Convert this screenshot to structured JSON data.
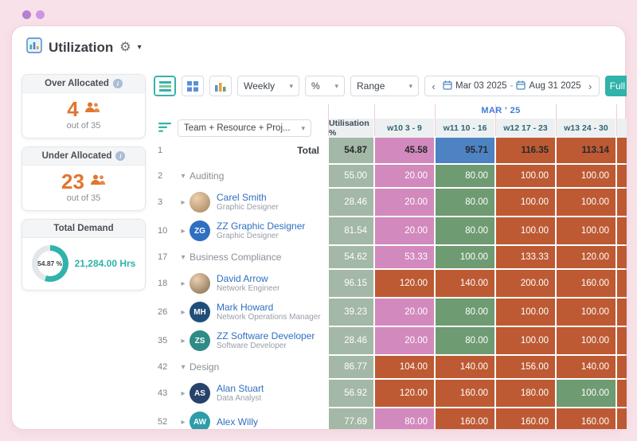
{
  "header": {
    "title": "Utilization"
  },
  "sidebar": {
    "over_allocated": {
      "label": "Over Allocated",
      "value": "4",
      "suffix": "out of 35"
    },
    "under_allocated": {
      "label": "Under Allocated",
      "value": "23",
      "suffix": "out of 35"
    },
    "total_demand": {
      "label": "Total Demand",
      "percent_text": "54.87 %",
      "percent_value": 54.87,
      "hours": "21,284.00 Hrs"
    }
  },
  "toolbar": {
    "period_select": "Weekly",
    "unit_select": "%",
    "range_select": "Range",
    "date_from": "Mar 03 2025",
    "date_separator": "-",
    "date_to": "Aug 31 2025",
    "full_button": "Full"
  },
  "palette": {
    "sage": "#a3b8a6",
    "pink": "#d289bd",
    "green": "#6e9b72",
    "red": "#bd5a33",
    "blue": "#4d82c3",
    "teal": "#2fb3aa",
    "orange": "#e0762f"
  },
  "table": {
    "month_label": "MAR ' 25",
    "columns": {
      "entity": "Team + Resource + Proj...",
      "utilisation": "Utilisation %",
      "weeks": [
        "w10 3 - 9",
        "w11 10 - 16",
        "w12 17 - 23",
        "w13 24 - 30"
      ]
    },
    "rows": [
      {
        "num": "1",
        "type": "total",
        "name": "Total",
        "util": "54.87",
        "cells": [
          {
            "v": "45.58",
            "c": "pink"
          },
          {
            "v": "95.71",
            "c": "blue"
          },
          {
            "v": "116.35",
            "c": "red"
          },
          {
            "v": "113.14",
            "c": "red"
          }
        ],
        "edge": "red"
      },
      {
        "num": "2",
        "type": "group",
        "name": "Auditing",
        "expanded": true,
        "util": "55.00",
        "cells": [
          {
            "v": "20.00",
            "c": "pink"
          },
          {
            "v": "80.00",
            "c": "green"
          },
          {
            "v": "100.00",
            "c": "red"
          },
          {
            "v": "100.00",
            "c": "red"
          }
        ],
        "edge": "red"
      },
      {
        "num": "3",
        "type": "resource",
        "name": "Carel Smith",
        "role": "Graphic Designer",
        "avatar": {
          "kind": "photo",
          "initials": "CS",
          "color": "#a5825f"
        },
        "util": "28.46",
        "cells": [
          {
            "v": "20.00",
            "c": "pink"
          },
          {
            "v": "80.00",
            "c": "green"
          },
          {
            "v": "100.00",
            "c": "red"
          },
          {
            "v": "100.00",
            "c": "red"
          }
        ],
        "edge": "red"
      },
      {
        "num": "10",
        "type": "resource",
        "name": "ZZ Graphic Designer",
        "role": "Graphic Designer",
        "avatar": {
          "kind": "initials",
          "initials": "ZG",
          "color": "#2f6fc2"
        },
        "util": "81.54",
        "cells": [
          {
            "v": "20.00",
            "c": "pink"
          },
          {
            "v": "80.00",
            "c": "green"
          },
          {
            "v": "100.00",
            "c": "red"
          },
          {
            "v": "100.00",
            "c": "red"
          }
        ],
        "edge": "red"
      },
      {
        "num": "17",
        "type": "group",
        "name": "Business Compliance",
        "expanded": true,
        "util": "54.62",
        "cells": [
          {
            "v": "53.33",
            "c": "pink"
          },
          {
            "v": "100.00",
            "c": "green"
          },
          {
            "v": "133.33",
            "c": "red"
          },
          {
            "v": "120.00",
            "c": "red"
          }
        ],
        "edge": "red"
      },
      {
        "num": "18",
        "type": "resource",
        "name": "David Arrow",
        "role": "Network Engineer",
        "avatar": {
          "kind": "photo",
          "initials": "DA",
          "color": "#7d6a4f"
        },
        "util": "96.15",
        "cells": [
          {
            "v": "120.00",
            "c": "red"
          },
          {
            "v": "140.00",
            "c": "red"
          },
          {
            "v": "200.00",
            "c": "red"
          },
          {
            "v": "160.00",
            "c": "red"
          }
        ],
        "edge": "red"
      },
      {
        "num": "26",
        "type": "resource",
        "name": "Mark Howard",
        "role": "Network Operations Manager",
        "avatar": {
          "kind": "initials",
          "initials": "MH",
          "color": "#1f4e79"
        },
        "util": "39.23",
        "cells": [
          {
            "v": "20.00",
            "c": "pink"
          },
          {
            "v": "80.00",
            "c": "green"
          },
          {
            "v": "100.00",
            "c": "red"
          },
          {
            "v": "100.00",
            "c": "red"
          }
        ],
        "edge": "red"
      },
      {
        "num": "35",
        "type": "resource",
        "name": "ZZ Software Developer",
        "role": "Software Developer",
        "avatar": {
          "kind": "initials",
          "initials": "ZS",
          "color": "#2e8b85"
        },
        "util": "28.46",
        "cells": [
          {
            "v": "20.00",
            "c": "pink"
          },
          {
            "v": "80.00",
            "c": "green"
          },
          {
            "v": "100.00",
            "c": "red"
          },
          {
            "v": "100.00",
            "c": "red"
          }
        ],
        "edge": "red"
      },
      {
        "num": "42",
        "type": "group",
        "name": "Design",
        "expanded": true,
        "util": "86.77",
        "cells": [
          {
            "v": "104.00",
            "c": "red"
          },
          {
            "v": "140.00",
            "c": "red"
          },
          {
            "v": "156.00",
            "c": "red"
          },
          {
            "v": "140.00",
            "c": "red"
          }
        ],
        "edge": "red"
      },
      {
        "num": "43",
        "type": "resource",
        "name": "Alan Stuart",
        "role": "Data Analyst",
        "avatar": {
          "kind": "initials",
          "initials": "AS",
          "color": "#27436b"
        },
        "util": "56.92",
        "cells": [
          {
            "v": "120.00",
            "c": "red"
          },
          {
            "v": "160.00",
            "c": "red"
          },
          {
            "v": "180.00",
            "c": "red"
          },
          {
            "v": "100.00",
            "c": "green"
          }
        ],
        "edge": "red"
      },
      {
        "num": "52",
        "type": "resource",
        "name": "Alex Willy",
        "role": "",
        "avatar": {
          "kind": "initials",
          "initials": "AW",
          "color": "#2d9da8"
        },
        "util": "77.69",
        "cells": [
          {
            "v": "80.00",
            "c": "pink"
          },
          {
            "v": "160.00",
            "c": "red"
          },
          {
            "v": "160.00",
            "c": "red"
          },
          {
            "v": "160.00",
            "c": "red"
          }
        ],
        "edge": "red"
      }
    ]
  }
}
